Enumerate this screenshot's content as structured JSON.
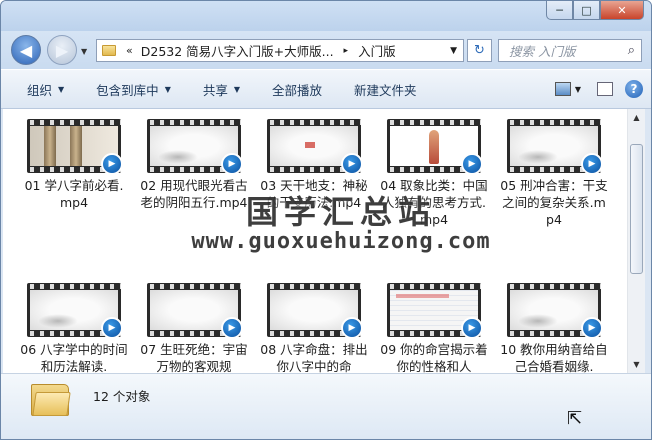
{
  "window": {
    "caption_buttons": [
      "─",
      "□",
      "✕"
    ]
  },
  "nav": {
    "address": {
      "prefix": "«",
      "crumb1": "D2532 简易八字入门版+大师版...",
      "separator": "▸",
      "crumb2": "入门版"
    },
    "search_placeholder": "搜索 入门版"
  },
  "toolbar": {
    "items": [
      {
        "label": "组织",
        "dropdown": true
      },
      {
        "label": "包含到库中",
        "dropdown": true
      },
      {
        "label": "共享",
        "dropdown": true
      },
      {
        "label": "全部播放",
        "dropdown": false
      },
      {
        "label": "新建文件夹",
        "dropdown": false
      }
    ],
    "help": "?"
  },
  "files": [
    {
      "label": "01 学八字前必看.mp4",
      "thumb": "pillars"
    },
    {
      "label": "02 用现代眼光看古老的阴阳五行.mp4",
      "thumb": "ink"
    },
    {
      "label": "03 天干地支：神秘的干支历法.mp4",
      "thumb": "red"
    },
    {
      "label": "04 取象比类：中国人独有的思考方式.mp4",
      "thumb": "body"
    },
    {
      "label": "05 刑冲合害：干支之间的复杂关系.mp4",
      "thumb": "ink"
    },
    {
      "label": "06 八字学中的时间和历法解读.",
      "thumb": "ink"
    },
    {
      "label": "07 生旺死绝：宇宙万物的客观规",
      "thumb": "plain"
    },
    {
      "label": "08 八字命盘：排出你八字中的命",
      "thumb": "plain"
    },
    {
      "label": "09 你的命宫揭示着你的性格和人",
      "thumb": "table"
    },
    {
      "label": "10 教你用纳音给自己合婚看姻缘.",
      "thumb": "ink"
    }
  ],
  "watermark": {
    "cn": "国学汇总站",
    "url": "www.guoxuehuizong.com"
  },
  "status": {
    "count": "12 个对象"
  }
}
